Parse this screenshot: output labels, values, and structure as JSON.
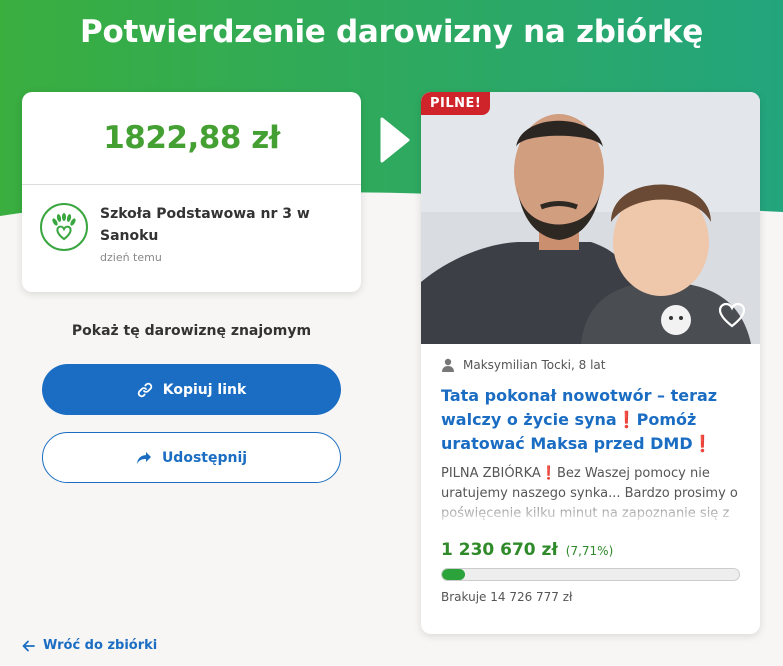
{
  "header": {
    "title": "Potwierdzenie darowizny na zbiórkę"
  },
  "donation": {
    "amount": "1822,88 zł",
    "donor_name": "Szkoła Podstawowa nr 3 w Sanoku",
    "time_ago": "dzień temu"
  },
  "share": {
    "label": "Pokaż tę darowiznę znajomym",
    "copy_link_label": "Kopiuj link",
    "share_label": "Udostępnij"
  },
  "back_link": {
    "label": "Wróć do zbiórki"
  },
  "campaign": {
    "badge": "PILNE!",
    "author": "Maksymilian Tocki, 8 lat",
    "title": "Tata pokonał nowotwór – teraz walczy o życie syna❗Pomóż uratować Maksa przed DMD❗",
    "description": "PILNA ZBIÓRKA❗Bez Waszej pomocy nie uratujemy naszego synka... Bardzo prosimy o poświęcenie kilku minut na zapoznanie się z naszą historią i pomoc w nagłośnieniu",
    "raised": "1 230 670 zł",
    "raised_percent": "(7,71%)",
    "progress_fraction": 0.0771,
    "missing": "Brakuje 14 726 777 zł"
  },
  "colors": {
    "hero_green": "#3aae3f",
    "hero_teal": "#23a57d",
    "amount_green": "#44a032",
    "primary_blue": "#1a6dc2",
    "urgent_red": "#d0242b"
  },
  "icons": [
    "arrow-right-icon",
    "heart-hands-logo",
    "link-icon",
    "share-arrow-icon",
    "back-arrow-icon",
    "person-icon",
    "heart-outline-icon"
  ]
}
